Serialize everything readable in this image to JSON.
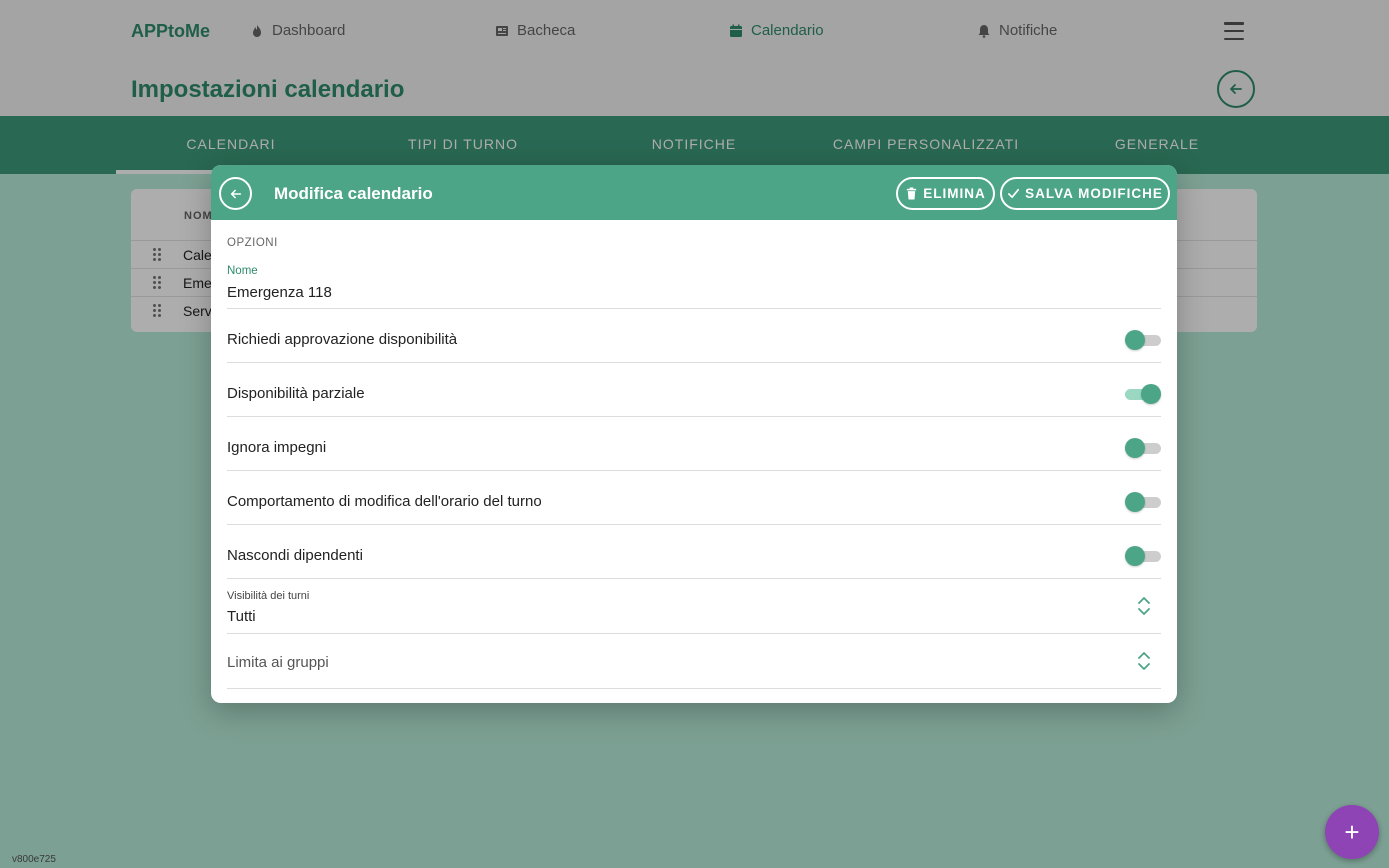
{
  "nav": {
    "brand": "APPtoMe",
    "items": [
      {
        "label": "Dashboard",
        "icon": "flame-icon"
      },
      {
        "label": "Bacheca",
        "icon": "newspaper-icon"
      },
      {
        "label": "Calendario",
        "icon": "calendar-icon",
        "active": true
      },
      {
        "label": "Notifiche",
        "icon": "bell-icon"
      }
    ],
    "menu_icon": "hamburger-icon"
  },
  "page": {
    "title": "Impostazioni calendario",
    "back_icon": "arrow-left-icon"
  },
  "tabs": [
    {
      "label": "CALENDARI",
      "active": true
    },
    {
      "label": "TIPI DI TURNO"
    },
    {
      "label": "NOTIFICHE"
    },
    {
      "label": "CAMPI PERSONALIZZATI"
    },
    {
      "label": "GENERALE"
    }
  ],
  "list": {
    "header": "NOME",
    "rows": [
      "Cale",
      "Eme",
      "Serv"
    ]
  },
  "version": "v800e725",
  "fab_label": "+",
  "modal": {
    "title": "Modifica calendario",
    "delete_label": "ELIMINA",
    "save_label": "SALVA MODIFICHE",
    "section": "OPZIONI",
    "name_label": "Nome",
    "name_value": "Emergenza 118",
    "options": [
      {
        "label": "Richiedi approvazione disponibilità",
        "on": false
      },
      {
        "label": "Disponibilità parziale",
        "on": true
      },
      {
        "label": "Ignora impegni",
        "on": false
      },
      {
        "label": "Comportamento di modifica dell'orario del turno",
        "on": false
      },
      {
        "label": "Nascondi dipendenti",
        "on": false
      }
    ],
    "visibility_label": "Visibilità dei turni",
    "visibility_value": "Tutti",
    "groups_placeholder": "Limita ai gruppi"
  },
  "colors": {
    "primary": "#4da588",
    "brand_text": "#2f8b6a",
    "fab": "#8e44b5"
  }
}
